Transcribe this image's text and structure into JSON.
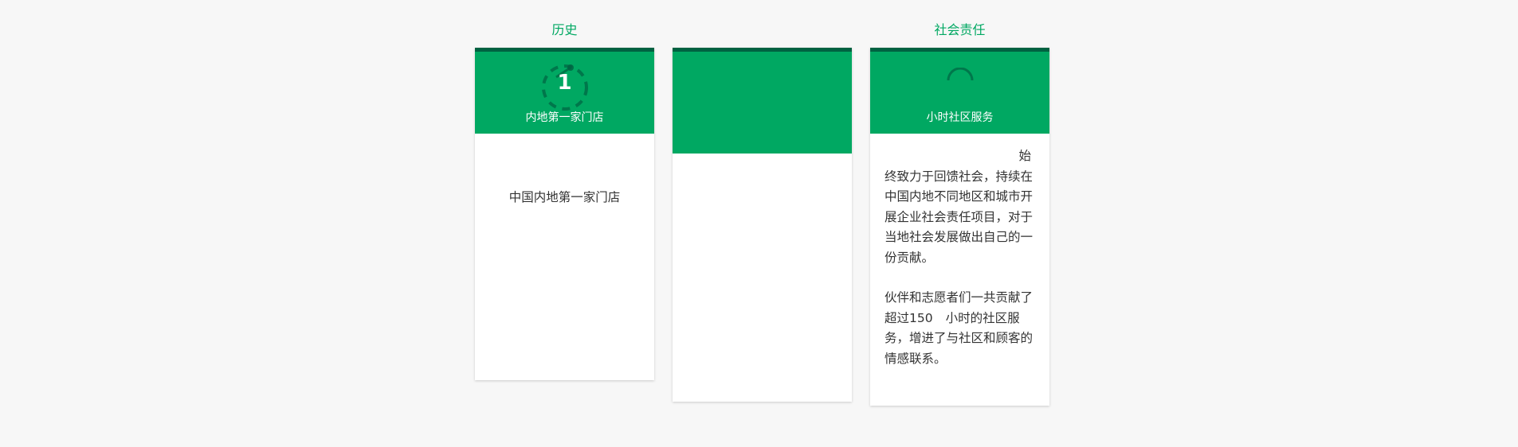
{
  "columns": {
    "history": {
      "title": "历史",
      "badge_number": "1",
      "subtitle": "内地第一家门店",
      "body": "中国内地第一家门店"
    },
    "middle": {
      "title": "",
      "subtitle": "",
      "body": ""
    },
    "csr": {
      "title": "社会责任",
      "subtitle": "小时社区服务",
      "body_lead": "始",
      "body_para1": "终致力于回馈社会，持续在中国内地不同地区和城市开展企业社会责任项目，对于当地社会发展做出自己的一份贡献。",
      "body_para2_a": "伙伴和志愿者们一共贡献了超过150",
      "body_para2_b": "小时的社区服务，增进了与社区和顾客的情感联系。"
    }
  },
  "colors": {
    "accent": "#00a862",
    "accent_dark": "#006241",
    "background": "#f7f7f7",
    "text": "#333333"
  }
}
